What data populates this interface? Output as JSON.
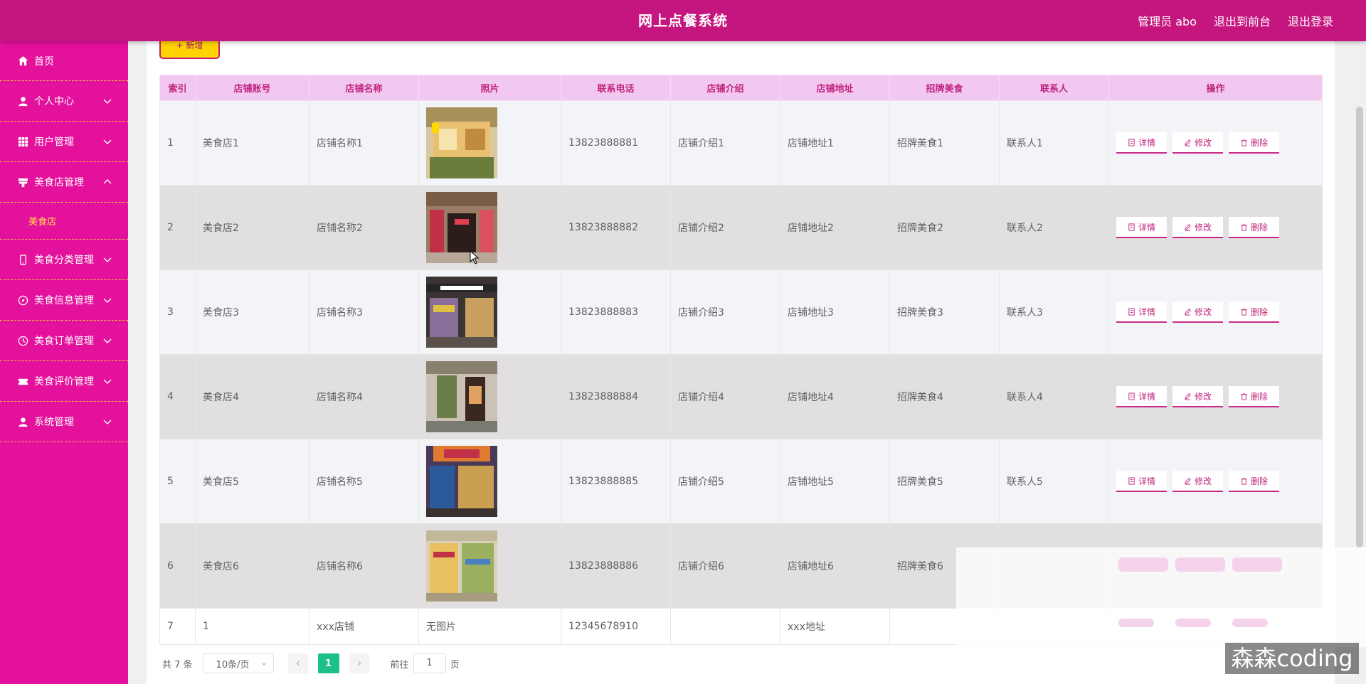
{
  "header": {
    "title": "网上点餐系统",
    "user": "管理员 abo",
    "to_front": "退出到前台",
    "logout": "退出登录"
  },
  "sidebar": {
    "items": [
      {
        "label": "首页",
        "icon": "home-icon"
      },
      {
        "label": "个人中心",
        "icon": "user-icon"
      },
      {
        "label": "用户管理",
        "icon": "grid-icon"
      },
      {
        "label": "美食店管理",
        "icon": "shop-icon",
        "expanded": true,
        "children": [
          "美食店"
        ]
      },
      {
        "label": "美食分类管理",
        "icon": "phone-icon"
      },
      {
        "label": "美食信息管理",
        "icon": "compass-icon"
      },
      {
        "label": "美食订单管理",
        "icon": "clock-icon"
      },
      {
        "label": "美食评价管理",
        "icon": "ticket-icon"
      },
      {
        "label": "系统管理",
        "icon": "user-icon"
      }
    ]
  },
  "toolbar": {
    "add_label": "+ 新增"
  },
  "table": {
    "headers": [
      "索引",
      "店铺账号",
      "店铺名称",
      "照片",
      "联系电话",
      "店铺介绍",
      "店铺地址",
      "招牌美食",
      "联系人",
      "操作"
    ],
    "rows": [
      {
        "index": "1",
        "account": "美食店1",
        "name": "店铺名称1",
        "photo": "store-photo-1",
        "phone": "13823888881",
        "intro": "店铺介绍1",
        "address": "店铺地址1",
        "signature": "招牌美食1",
        "contact": "联系人1"
      },
      {
        "index": "2",
        "account": "美食店2",
        "name": "店铺名称2",
        "photo": "store-photo-2",
        "phone": "13823888882",
        "intro": "店铺介绍2",
        "address": "店铺地址2",
        "signature": "招牌美食2",
        "contact": "联系人2"
      },
      {
        "index": "3",
        "account": "美食店3",
        "name": "店铺名称3",
        "photo": "store-photo-3",
        "phone": "13823888883",
        "intro": "店铺介绍3",
        "address": "店铺地址3",
        "signature": "招牌美食3",
        "contact": "联系人3"
      },
      {
        "index": "4",
        "account": "美食店4",
        "name": "店铺名称4",
        "photo": "store-photo-4",
        "phone": "13823888884",
        "intro": "店铺介绍4",
        "address": "店铺地址4",
        "signature": "招牌美食4",
        "contact": "联系人4"
      },
      {
        "index": "5",
        "account": "美食店5",
        "name": "店铺名称5",
        "photo": "store-photo-5",
        "phone": "13823888885",
        "intro": "店铺介绍5",
        "address": "店铺地址5",
        "signature": "招牌美食5",
        "contact": "联系人5"
      },
      {
        "index": "6",
        "account": "美食店6",
        "name": "店铺名称6",
        "photo": "store-photo-6",
        "phone": "13823888886",
        "intro": "店铺介绍6",
        "address": "店铺地址6",
        "signature": "招牌美食6",
        "contact": ""
      },
      {
        "index": "7",
        "account": "1",
        "name": "xxx店铺",
        "photo_text": "无图片",
        "phone": "12345678910",
        "intro": "",
        "address": "xxx地址",
        "signature": "",
        "contact": ""
      }
    ],
    "actions": {
      "detail": "详情",
      "edit": "修改",
      "delete": "删除"
    }
  },
  "pagination": {
    "total": "共 7 条",
    "page_size": "10条/页",
    "current": "1",
    "goto_prefix": "前往",
    "goto_value": "1",
    "goto_suffix": "页"
  },
  "watermark": "森森coding",
  "colors": {
    "header_bg": "#c5157e",
    "sidebar_bg": "#e3119c",
    "table_header_bg": "#f2c8f0",
    "active_page": "#1ec08a",
    "add_button": "#ffd400"
  }
}
